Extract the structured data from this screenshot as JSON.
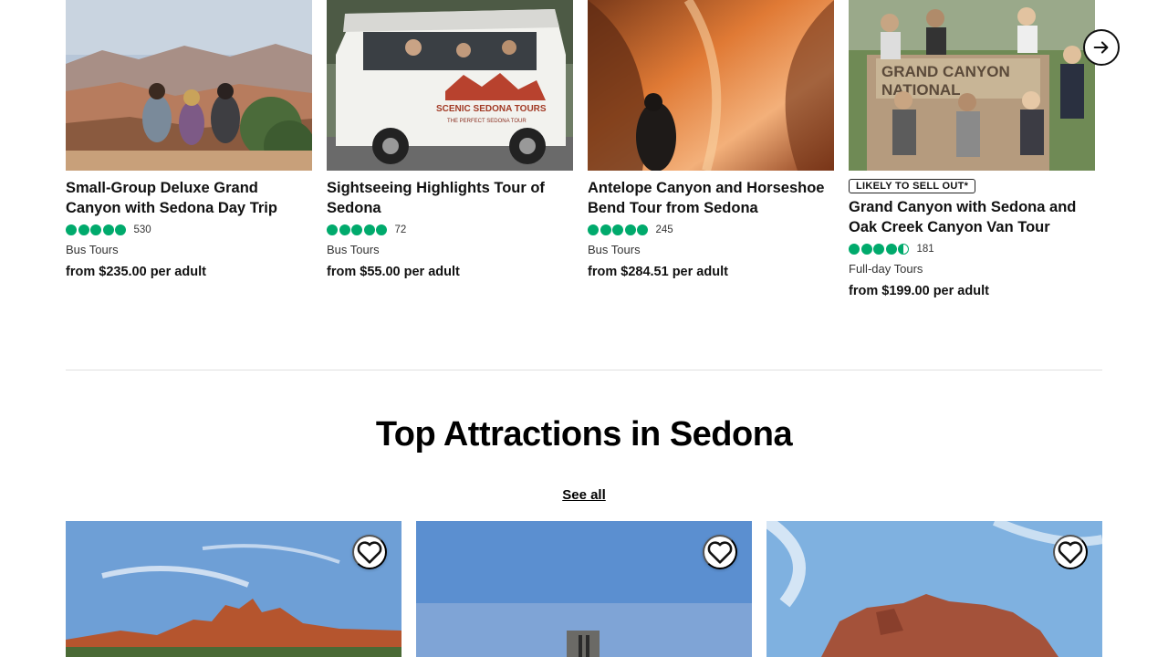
{
  "tours": [
    {
      "title": "Small-Group Deluxe Grand Canyon with Sedona Day Trip",
      "rating": 5,
      "review_count": "530",
      "category": "Bus Tours",
      "price": "from $235.00 per adult"
    },
    {
      "title": "Sightseeing Highlights Tour of Sedona",
      "rating": 5,
      "review_count": "72",
      "category": "Bus Tours",
      "price": "from $55.00 per adult",
      "photo_text": {
        "van_brand": "SCENIC SEDONA TOURS",
        "van_tagline": "THE PERFECT SEDONA TOUR"
      }
    },
    {
      "title": "Antelope Canyon and Horseshoe Bend Tour from Sedona",
      "rating": 5,
      "review_count": "245",
      "category": "Bus Tours",
      "price": "from $284.51 per adult"
    },
    {
      "badge": "LIKELY TO SELL OUT*",
      "title": "Grand Canyon with Sedona and Oak Creek Canyon Van Tour",
      "rating": 4.5,
      "review_count": "181",
      "category": "Full-day Tours",
      "price": "from $199.00 per adult",
      "photo_text": {
        "sign_line1": "GRAND CANYON",
        "sign_line2": "NATIONAL"
      }
    }
  ],
  "section": {
    "title": "Top Attractions in Sedona",
    "see_all": "See all"
  },
  "colors": {
    "rating_green": "#00aa6c",
    "text": "#111111"
  },
  "icons": {
    "next": "arrow-right-icon",
    "favorite": "heart-outline-icon"
  }
}
